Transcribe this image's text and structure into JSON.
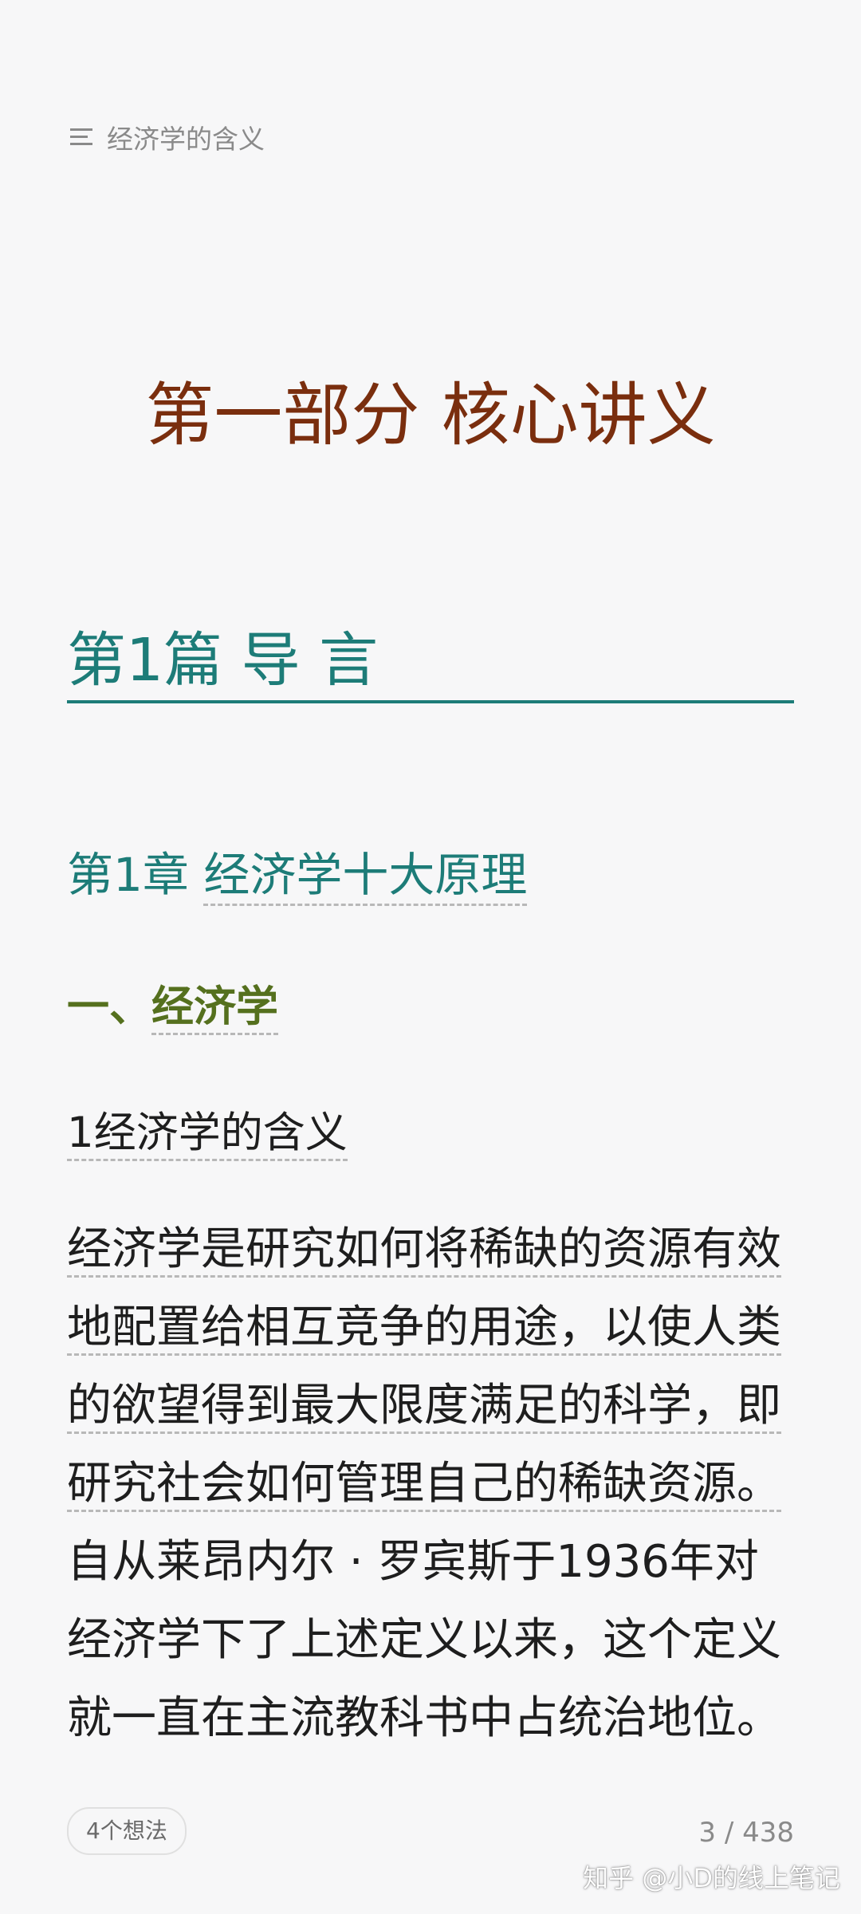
{
  "header": {
    "menu_icon": "menu-icon",
    "title": "经济学的含义"
  },
  "content": {
    "part_title": "第一部分 核心讲义",
    "section_title": "第1篇 导 言",
    "chapter": {
      "number": "第1章",
      "title": "经济学十大原理"
    },
    "subsection": {
      "prefix": "一、",
      "title": "经济学"
    },
    "item": {
      "number": "1",
      "title": "经济学的含义"
    },
    "paragraph_lines": [
      "经济学是研究如何将稀缺的资源有效",
      "地配置给相互竞争的用途，以使人类",
      "的欲望得到最大限度满足的科学，即",
      "研究社会如何管理自己的稀缺资源。",
      "自从莱昂内尔 · 罗宾斯于1936年对",
      "经济学下了上述定义以来，这个定义",
      "就一直在主流教科书中占统治地位。"
    ]
  },
  "footer": {
    "thoughts_label": "4个想法",
    "page_indicator": "3 / 438",
    "watermark": "知乎 @小D的线上笔记"
  },
  "colors": {
    "part_title": "#7a2e0e",
    "section": "#1d7c78",
    "subsection": "#55701e",
    "background": "#f7f7f8"
  }
}
